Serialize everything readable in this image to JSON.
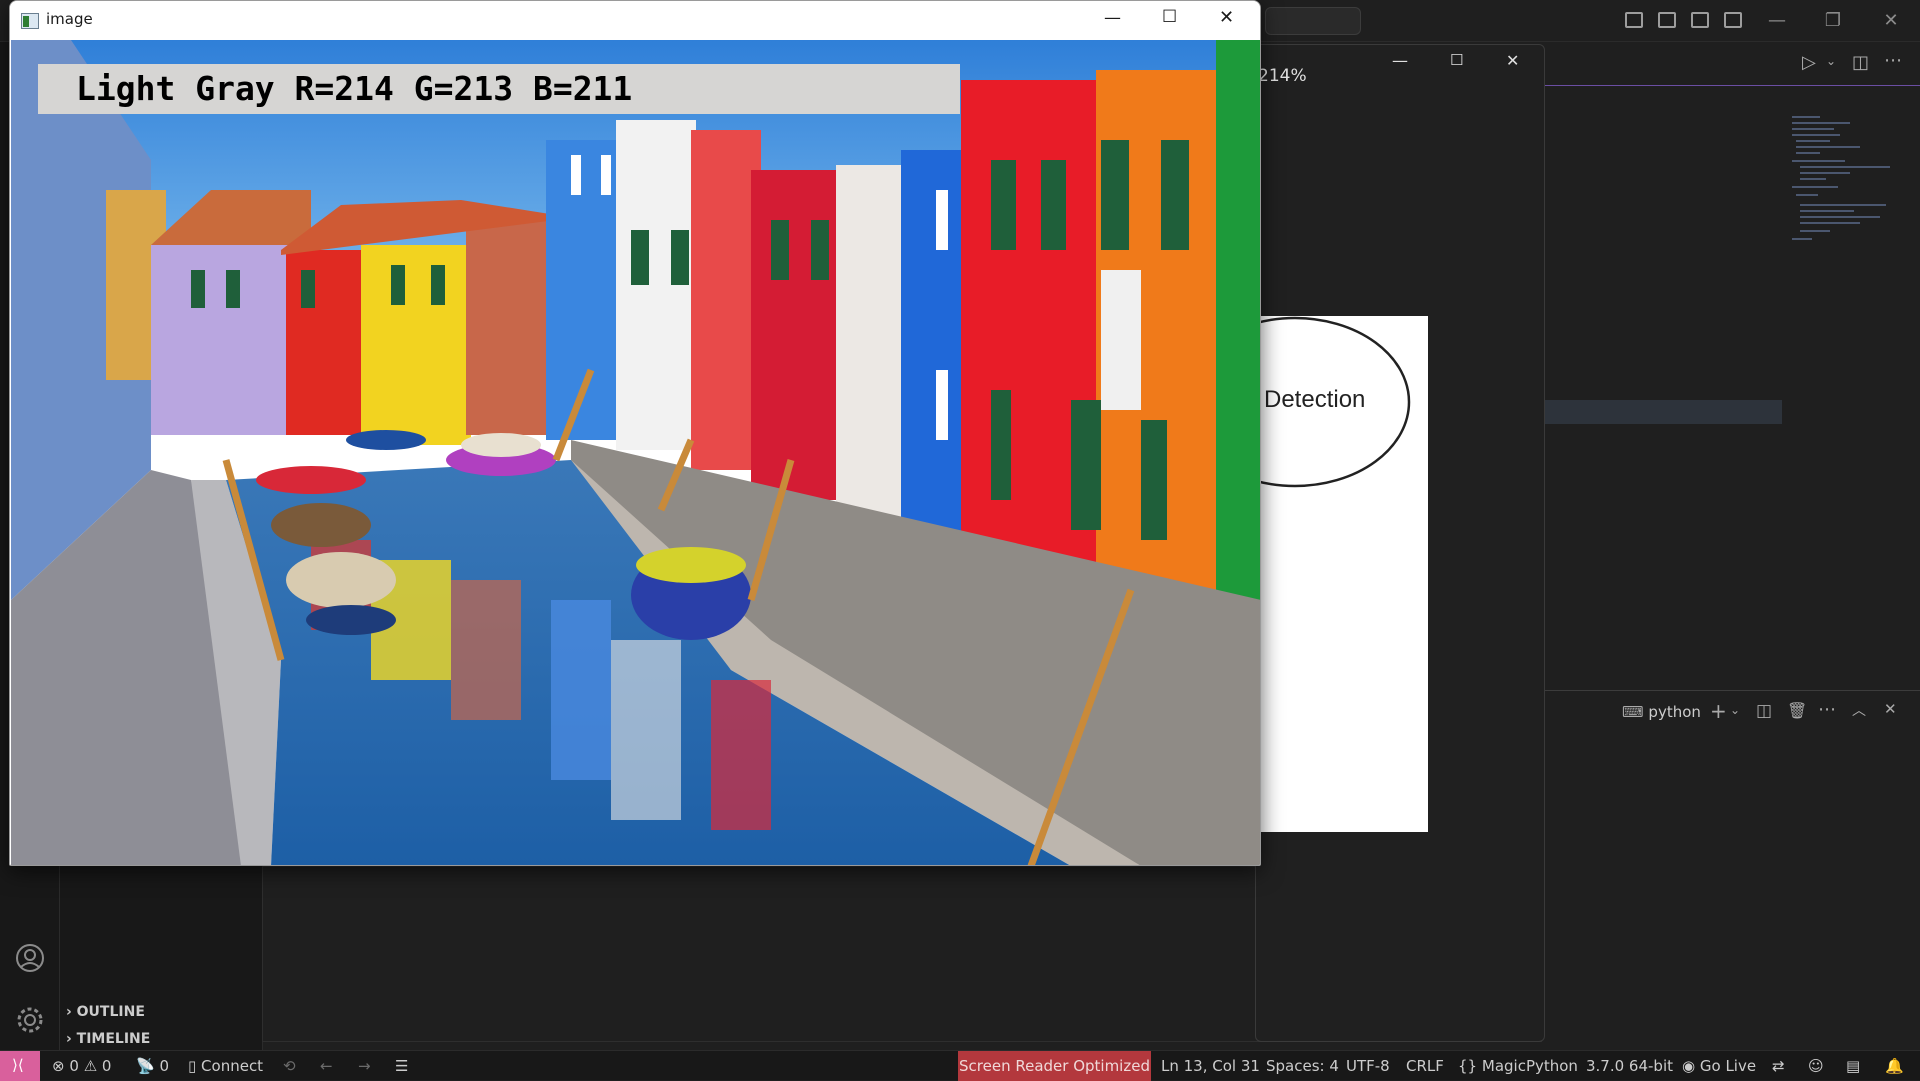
{
  "image_window": {
    "title": "image",
    "detected_color_text": "Light Gray R=214 G=213 B=211"
  },
  "plot_window": {
    "zoom_text": "214%",
    "ellipse_label": "Detection"
  },
  "sidebar": {
    "sections": [
      {
        "label": "OUTLINE"
      },
      {
        "label": "TIMELINE"
      }
    ]
  },
  "terminal": {
    "name": "python"
  },
  "statusbar": {
    "errors": "0",
    "warnings": "0",
    "ports": "0",
    "connect": "Connect",
    "screen_reader": "Screen Reader Optimized",
    "cursor_position": "Ln 13, Col 31",
    "indentation": "Spaces: 4",
    "encoding": "UTF-8",
    "eol": "CRLF",
    "language": "MagicPython",
    "interpreter": "3.7.0 64-bit",
    "go_live": "Go Live"
  },
  "colors": {
    "accent_pink": "#d9609c",
    "screen_reader_bg": "#b3383d",
    "editor_bg": "#1f1f1f",
    "sidebar_bg": "#181818"
  }
}
